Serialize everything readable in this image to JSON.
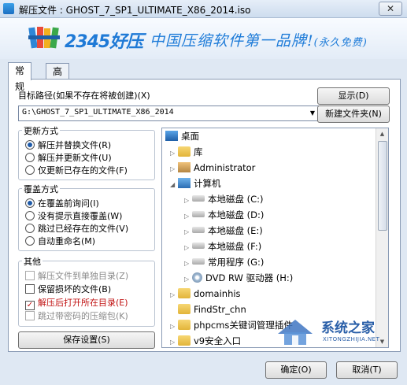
{
  "window": {
    "title": "解压文件 : GHOST_7_SP1_ULTIMATE_X86_2014.iso",
    "close_label": "✕"
  },
  "banner": {
    "brand": "2345好压",
    "slogan": "中国压缩软件第一品牌!",
    "slogan_suffix": "(永久免费)"
  },
  "tabs": [
    {
      "label": "常规",
      "active": true
    },
    {
      "label": "高级",
      "active": false
    }
  ],
  "target": {
    "label": "目标路径(如果不存在将被创建)(X)",
    "value": "G:\\GHOST_7_SP1_ULTIMATE_X86_2014",
    "show_button": "显示(D)",
    "new_folder_button": "新建文件夹(N)"
  },
  "update_mode": {
    "title": "更新方式",
    "options": [
      {
        "label": "解压并替换文件(R)",
        "selected": true
      },
      {
        "label": "解压并更新文件(U)",
        "selected": false
      },
      {
        "label": "仅更新已存在的文件(F)",
        "selected": false
      }
    ]
  },
  "overwrite_mode": {
    "title": "覆盖方式",
    "options": [
      {
        "label": "在覆盖前询问(I)",
        "selected": true
      },
      {
        "label": "没有提示直接覆盖(W)",
        "selected": false
      },
      {
        "label": "跳过已经存在的文件(V)",
        "selected": false
      },
      {
        "label": "自动重命名(M)",
        "selected": false
      }
    ]
  },
  "other": {
    "title": "其他",
    "options": [
      {
        "label": "解压文件到单独目录(Z)",
        "checked": false,
        "disabled": true
      },
      {
        "label": "保留损坏的文件(B)",
        "checked": false,
        "disabled": false
      },
      {
        "label": "解压后打开所在目录(E)",
        "checked": true,
        "disabled": false
      },
      {
        "label": "跳过带密码的压缩包(K)",
        "checked": false,
        "disabled": true
      }
    ]
  },
  "save_settings_button": "保存设置(S)",
  "tree": {
    "nodes": [
      {
        "label": "桌面",
        "icon": "desktop-icon"
      },
      {
        "label": "库",
        "icon": "library-icon"
      },
      {
        "label": "Administrator",
        "icon": "user-folder-icon"
      },
      {
        "label": "计算机",
        "icon": "computer-icon"
      },
      {
        "label": "本地磁盘 (C:)",
        "icon": "drive-icon"
      },
      {
        "label": "本地磁盘 (D:)",
        "icon": "drive-icon"
      },
      {
        "label": "本地磁盘 (E:)",
        "icon": "drive-icon"
      },
      {
        "label": "本地磁盘 (F:)",
        "icon": "drive-icon"
      },
      {
        "label": "常用程序 (G:)",
        "icon": "drive-icon"
      },
      {
        "label": "DVD RW 驱动器 (H:)",
        "icon": "dvd-icon"
      },
      {
        "label": "domainhis",
        "icon": "folder-icon"
      },
      {
        "label": "FindStr_chn",
        "icon": "folder-icon"
      },
      {
        "label": "phpcms关键词管理插件",
        "icon": "folder-icon"
      },
      {
        "label": "v9安全入口",
        "icon": "folder-icon"
      }
    ]
  },
  "ok_button": "确定(O)",
  "cancel_button": "取消(T)",
  "watermark": {
    "text": "系统之家",
    "sub": "XITONGZHIJIA.NET"
  }
}
